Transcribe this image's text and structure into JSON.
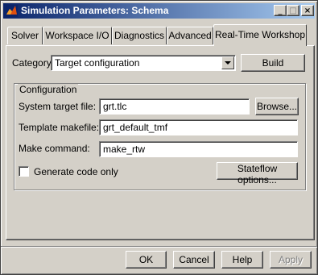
{
  "window": {
    "title": "Simulation Parameters: Schema",
    "controls": {
      "minimize": "_",
      "maximize": "□",
      "close": "×"
    }
  },
  "tabs": [
    {
      "label": "Solver"
    },
    {
      "label": "Workspace I/O"
    },
    {
      "label": "Diagnostics"
    },
    {
      "label": "Advanced"
    },
    {
      "label": "Real-Time Workshop",
      "active": true
    }
  ],
  "category": {
    "label": "Category:",
    "selected": "Target configuration",
    "build_label": "Build"
  },
  "configuration": {
    "group_title": "Configuration",
    "system_target_file": {
      "label": "System target file:",
      "value": "grt.tlc",
      "browse_label": "Browse..."
    },
    "template_makefile": {
      "label": "Template makefile:",
      "value": "grt_default_tmf"
    },
    "make_command": {
      "label": "Make command:",
      "value": "make_rtw"
    },
    "generate_code_only": {
      "label": "Generate code only",
      "checked": false
    },
    "stateflow_options_label": "Stateflow options..."
  },
  "footer": {
    "ok_label": "OK",
    "cancel_label": "Cancel",
    "help_label": "Help",
    "apply_label": "Apply",
    "apply_disabled": true
  },
  "icons": {
    "app": "matlab-logo-icon"
  },
  "colors": {
    "title_start": "#0a246a",
    "title_end": "#a6caf0",
    "face": "#d4d0c8"
  }
}
